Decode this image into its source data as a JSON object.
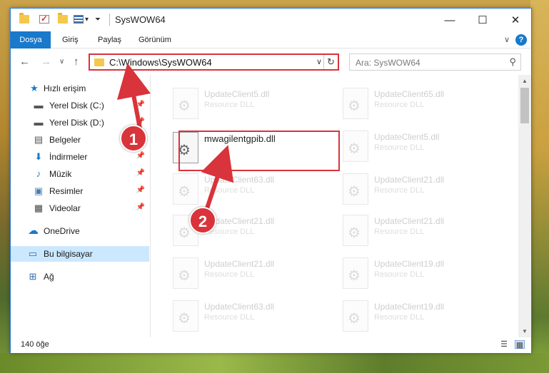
{
  "window": {
    "title": "SysWOW64",
    "accent": "#1979ca",
    "highlight_color": "#d9333b"
  },
  "ribbon": {
    "tabs": [
      "Dosya",
      "Giriş",
      "Paylaş",
      "Görünüm"
    ],
    "help": "?"
  },
  "address": {
    "path": "C:\\Windows\\SysWOW64",
    "search_placeholder": "Ara: SysWOW64"
  },
  "nav": {
    "items": [
      {
        "label": "Hızlı erişim",
        "icon": "star-icon"
      },
      {
        "label": "Yerel Disk (C:)",
        "icon": "drive-icon"
      },
      {
        "label": "Yerel Disk (D:)",
        "icon": "drive-icon"
      },
      {
        "label": "Belgeler",
        "icon": "documents-icon"
      },
      {
        "label": "İndirmeler",
        "icon": "download-icon"
      },
      {
        "label": "Müzik",
        "icon": "music-icon"
      },
      {
        "label": "Resimler",
        "icon": "pictures-icon"
      },
      {
        "label": "Videolar",
        "icon": "videos-icon"
      },
      {
        "label": "OneDrive",
        "icon": "cloud-icon"
      },
      {
        "label": "Bu bilgisayar",
        "icon": "computer-icon"
      },
      {
        "label": "Ağ",
        "icon": "network-icon"
      }
    ],
    "selected": "Bu bilgisayar"
  },
  "files": {
    "highlighted": {
      "name": "mwagilentgpib.dll"
    },
    "left_column": [
      {
        "name": "UpdateClient5.dll",
        "type": "Resource DLL"
      },
      {
        "name": "UpdateClient63.dll",
        "type": "Resource DLL"
      },
      {
        "name": "UpdateClient21.dll",
        "type": "Resource DLL"
      },
      {
        "name": "UpdateClient21.dll",
        "type": "Resource DLL"
      },
      {
        "name": "UpdateClient63.dll",
        "type": "Resource DLL"
      }
    ],
    "right_column": [
      {
        "name": "UpdateClient65.dll",
        "type": "Resource DLL"
      },
      {
        "name": "UpdateClient5.dll",
        "type": "Resource DLL"
      },
      {
        "name": "UpdateClient21.dll",
        "type": "Resource DLL"
      },
      {
        "name": "UpdateClient21.dll",
        "type": "Resource DLL"
      },
      {
        "name": "UpdateClient19.dll",
        "type": "Resource DLL"
      },
      {
        "name": "UpdateClient19.dll",
        "type": "Resource DLL"
      }
    ]
  },
  "status": {
    "count": "140 öğe"
  },
  "annotations": {
    "badge_1": "1",
    "badge_2": "2"
  }
}
